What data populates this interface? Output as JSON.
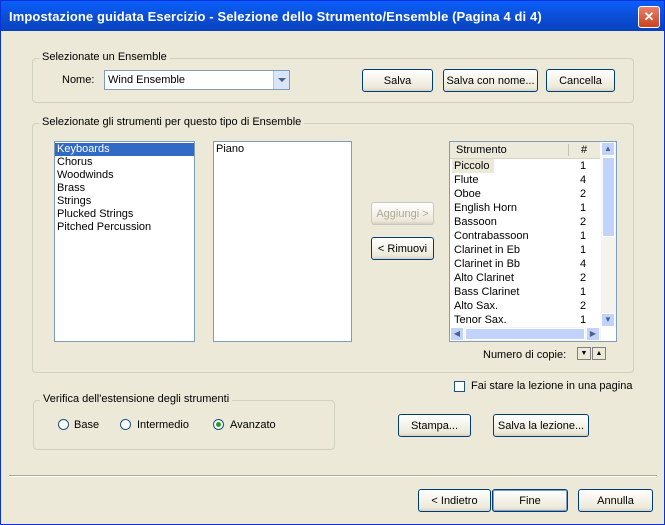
{
  "window": {
    "title": "Impostazione guidata Esercizio - Selezione dello Strumento/Ensemble (Pagina 4 di 4)",
    "close_glyph": "✕"
  },
  "ensemble_group": {
    "legend": "Selezionate un Ensemble",
    "name_label": "Nome:",
    "name_value": "Wind Ensemble",
    "save_label": "Salva",
    "save_as_label": "Salva con nome...",
    "delete_label": "Cancella"
  },
  "instruments_group": {
    "legend": "Selezionate gli strumenti per questo tipo di Ensemble",
    "families": [
      "Keyboards",
      "Chorus",
      "Woodwinds",
      "Brass",
      "Strings",
      "Plucked Strings",
      "Pitched Percussion"
    ],
    "selected_family_index": 0,
    "available": [
      "Piano"
    ],
    "add_label": "Aggiungi >",
    "remove_label": "< Rimuovi",
    "table_headers": {
      "instrument": "Strumento",
      "count": "#"
    },
    "table_rows": [
      {
        "name": "Piccolo",
        "count": "1"
      },
      {
        "name": "Flute",
        "count": "4"
      },
      {
        "name": "Oboe",
        "count": "2"
      },
      {
        "name": "English Horn",
        "count": "1"
      },
      {
        "name": "Bassoon",
        "count": "2"
      },
      {
        "name": "Contrabassoon",
        "count": "1"
      },
      {
        "name": "Clarinet in Eb",
        "count": "1"
      },
      {
        "name": "Clarinet in Bb",
        "count": "4"
      },
      {
        "name": "Alto Clarinet",
        "count": "2"
      },
      {
        "name": "Bass Clarinet",
        "count": "1"
      },
      {
        "name": "Alto Sax.",
        "count": "2"
      },
      {
        "name": "Tenor Sax.",
        "count": "1"
      }
    ],
    "copies_label": "Numero di copie:"
  },
  "one_page": {
    "label": "Fai stare la lezione in una pagina",
    "checked": false
  },
  "range_group": {
    "legend": "Verifica dell'estensione degli strumenti",
    "options": [
      "Base",
      "Intermedio",
      "Avanzato"
    ],
    "selected": "Avanzato"
  },
  "actions": {
    "print_label": "Stampa...",
    "save_lesson_label": "Salva la lezione..."
  },
  "nav": {
    "back_label": "< Indietro",
    "finish_label": "Fine",
    "cancel_label": "Annulla"
  }
}
